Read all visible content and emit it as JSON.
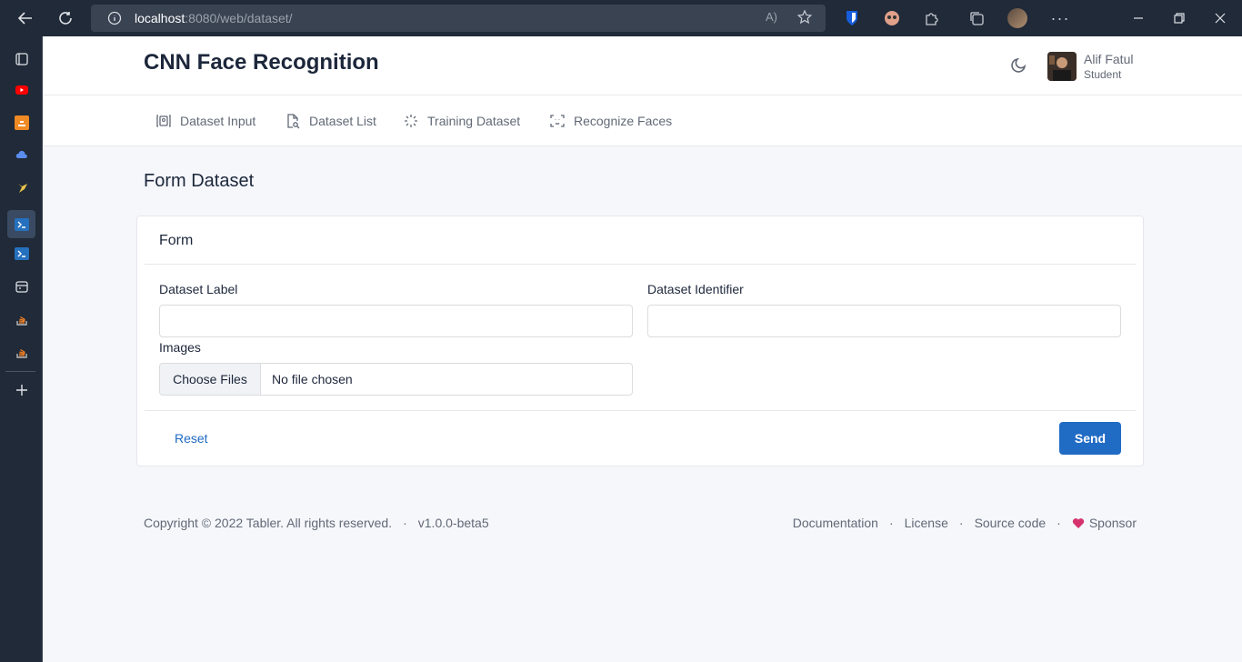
{
  "browser": {
    "url_host": "localhost",
    "url_rest": ":8080/web/dataset/"
  },
  "header": {
    "brand": "CNN Face Recognition",
    "user_name": "Alif Fatul",
    "user_role": "Student"
  },
  "nav": {
    "items": [
      {
        "label": "Dataset Input",
        "icon": "id-card-icon"
      },
      {
        "label": "Dataset List",
        "icon": "file-search-icon"
      },
      {
        "label": "Training Dataset",
        "icon": "loader-icon"
      },
      {
        "label": "Recognize Faces",
        "icon": "face-scan-icon"
      }
    ]
  },
  "page": {
    "title": "Form Dataset"
  },
  "form": {
    "card_title": "Form",
    "label_field": "Dataset Label",
    "identifier_field": "Dataset Identifier",
    "images_field": "Images",
    "choose_files": "Choose Files",
    "no_file": "No file chosen",
    "reset": "Reset",
    "send": "Send"
  },
  "footer": {
    "copyright": "Copyright © 2022 Tabler. All rights reserved.",
    "version": "v1.0.0-beta5",
    "links": [
      "Documentation",
      "License",
      "Source code",
      "Sponsor"
    ]
  },
  "colors": {
    "primary": "#206bc4",
    "heart": "#d6336c",
    "browser": "#202a38"
  }
}
